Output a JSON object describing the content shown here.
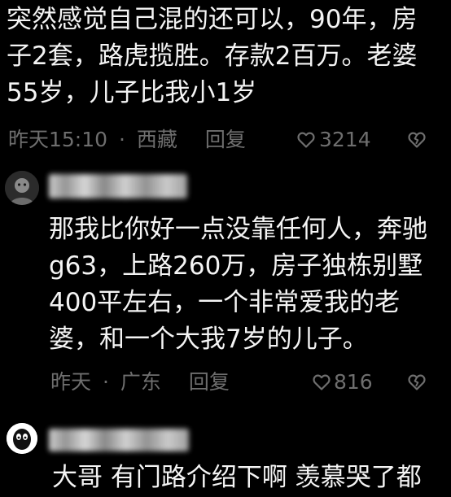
{
  "comments": [
    {
      "text": "突然感觉自己混的还可以，90年，房子2套，路虎揽胜。存款2百万。老婆55岁，儿子比我小1岁",
      "time": "昨天15:10",
      "dot": "·",
      "location": "西藏",
      "reply_label": "回复",
      "likes": "3214"
    },
    {
      "text": "那我比你好一点没靠任何人，奔驰g63，上路260万，房子独栋别墅400平左右，一个非常爱我的老婆，和一个大我7岁的儿子。",
      "time": "昨天",
      "dot": "·",
      "location": "广东",
      "reply_label": "回复",
      "likes": "816"
    },
    {
      "text": "大哥 有门路介绍下啊 羡慕哭了都"
    }
  ],
  "icons": {
    "like": "heart-outline-icon",
    "dislike": "broken-heart-icon"
  },
  "colors": {
    "background": "#000000",
    "text": "#f4f4f4",
    "meta": "#6e6e6e"
  }
}
